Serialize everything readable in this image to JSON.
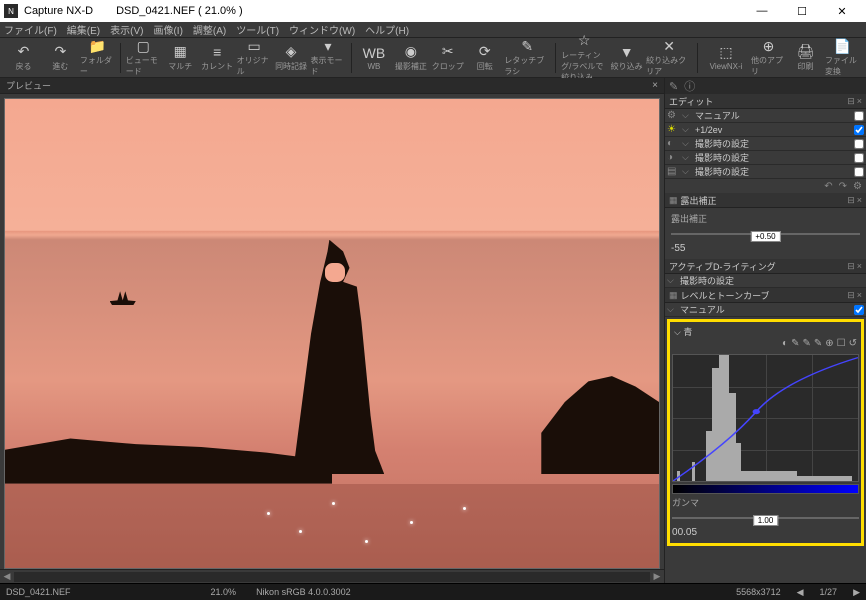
{
  "titlebar": {
    "app": "Capture NX-D",
    "file": "DSD_0421.NEF ( 21.0% )"
  },
  "wincontrols": {
    "min": "—",
    "max": "☐",
    "close": "✕"
  },
  "menubar": [
    "ファイル(F)",
    "編集(E)",
    "表示(V)",
    "画像(I)",
    "調整(A)",
    "ツール(T)",
    "ウィンドウ(W)",
    "ヘルプ(H)"
  ],
  "toolbar": [
    {
      "ic": "↶",
      "lbl": "戻る"
    },
    {
      "ic": "↷",
      "lbl": "進む"
    },
    {
      "ic": "📁",
      "lbl": "フォルダー"
    },
    {
      "sep": true
    },
    {
      "ic": "▢",
      "lbl": "ビューモード"
    },
    {
      "ic": "▦",
      "lbl": "マルチ"
    },
    {
      "ic": "≡",
      "lbl": "カレント"
    },
    {
      "ic": "▭",
      "lbl": "オリジナル"
    },
    {
      "ic": "◈",
      "lbl": "同時記録"
    },
    {
      "ic": "▾",
      "lbl": "表示モード"
    },
    {
      "sep": true
    },
    {
      "ic": "WB",
      "lbl": "WB"
    },
    {
      "ic": "◉",
      "lbl": "撮影補正"
    },
    {
      "ic": "✂",
      "lbl": "クロップ"
    },
    {
      "ic": "⟳",
      "lbl": "回転"
    },
    {
      "ic": "✎",
      "lbl": "レタッチブラシ"
    },
    {
      "sep": true
    },
    {
      "ic": "☆",
      "lbl": "レーティング/ラベルで絞り込み"
    },
    {
      "ic": "▼",
      "lbl": "絞り込み"
    },
    {
      "ic": "✕",
      "lbl": "絞り込みクリア"
    },
    {
      "sep": true
    },
    {
      "ic": "⬚",
      "lbl": "ViewNX-i"
    },
    {
      "ic": "⊕",
      "lbl": "他のアプリ"
    },
    {
      "ic": "🖨",
      "lbl": "印刷"
    },
    {
      "ic": "📄",
      "lbl": "ファイル変換"
    }
  ],
  "preview_tab": {
    "label": "プレビュー"
  },
  "edit": {
    "header": "エディット",
    "rows": [
      {
        "gear": "⚙",
        "chev": "⌵",
        "val": "マニュアル",
        "chk": false
      },
      {
        "gear": "☀",
        "chev": "⌵",
        "val": "+1/2ev",
        "chk": true,
        "y": true
      },
      {
        "gear": "◐",
        "chev": "⌵",
        "val": "撮影時の設定",
        "chk": false
      },
      {
        "gear": "◑",
        "chev": "⌵",
        "val": "撮影時の設定",
        "chk": false
      },
      {
        "gear": "▤",
        "chev": "⌵",
        "val": "撮影時の設定",
        "chk": false
      }
    ],
    "exposure": {
      "title": "露出補正",
      "label": "露出補正",
      "val": "+0.50",
      "min": "-5",
      "max": "5"
    },
    "dlighting": {
      "title": "アクティブD-ライティング",
      "val": "撮影時の設定"
    },
    "curves": {
      "title": "レベルとトーンカーブ",
      "sub": "マニュアル",
      "channel": "⌵ 青",
      "tools": [
        "◐",
        "✎",
        "✎",
        "✎",
        "⊕",
        "☐",
        "↺"
      ],
      "gamma_lbl": "ガンマ",
      "gamma_val": "1.00",
      "min": "0",
      "max": "0.05"
    }
  },
  "status": {
    "file": "DSD_0421.NEF",
    "zoom": "21.0%",
    "profile": "Nikon sRGB 4.0.0.3002",
    "dims": "5568x3712",
    "page": "1/27"
  }
}
